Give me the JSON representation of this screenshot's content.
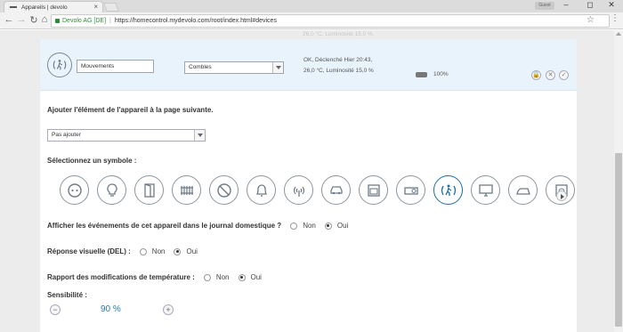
{
  "browser": {
    "tab_title": "Appareils | devolo",
    "tab_close": "×",
    "user_badge": "Guest",
    "window_controls": [
      "–",
      "◻",
      "✕"
    ],
    "nav": {
      "back": "←",
      "forward": "→",
      "reload": "↻",
      "home": "⌂"
    },
    "site_name": "Devolo AG [DE]",
    "url": "https://homecontrol.mydevolo.com/root/index.html#devices",
    "star": "☆",
    "menu": "⋮"
  },
  "ghost_text": "26,0 °C, Luminosité 15,0 %",
  "device": {
    "name_value": "Mouvements",
    "room_value": "Combles",
    "status_line1": "OK, Déclenché Hier 20:43,",
    "status_line2": "26,0 °C, Luminosité 15,0 %",
    "battery_pct": "100%",
    "battery_level": 1.0,
    "action_icons": [
      "lock-icon",
      "close-icon",
      "check-icon"
    ],
    "action_glyphs": [
      "🔒",
      "✕",
      "✓"
    ]
  },
  "add_to_page": {
    "label": "Ajouter l'élément de l'appareil à la page suivante.",
    "selected": "Pas ajouter"
  },
  "symbols": {
    "label": "Sélectionnez un symbole :",
    "icons": [
      "outlet-icon",
      "bulb-icon",
      "door-icon",
      "radiator-icon",
      "no-entry-icon",
      "bell-icon",
      "signal-icon",
      "car-icon",
      "oven-icon",
      "projector-icon",
      "motion-icon",
      "monitor-icon",
      "iron-icon",
      "washer-icon"
    ],
    "selected_index": 10
  },
  "journal": {
    "label": "Afficher les événements de cet appareil dans le journal domestique ?",
    "no": "Non",
    "yes": "Oui",
    "selected": "Oui"
  },
  "led": {
    "label": "Réponse visuelle (DEL) :",
    "no": "Non",
    "yes": "Oui",
    "selected": "Oui"
  },
  "temperature": {
    "label": "Rapport des modifications de température :",
    "no": "Non",
    "yes": "Oui",
    "selected": "Oui"
  },
  "sensitivity": {
    "label": "Sensibilité :",
    "value": "90 %",
    "minus": "−",
    "plus": "+"
  },
  "colors": {
    "accent": "#2578b5",
    "row_bg": "#e9f3fb",
    "secure": "#2e8b3a"
  }
}
